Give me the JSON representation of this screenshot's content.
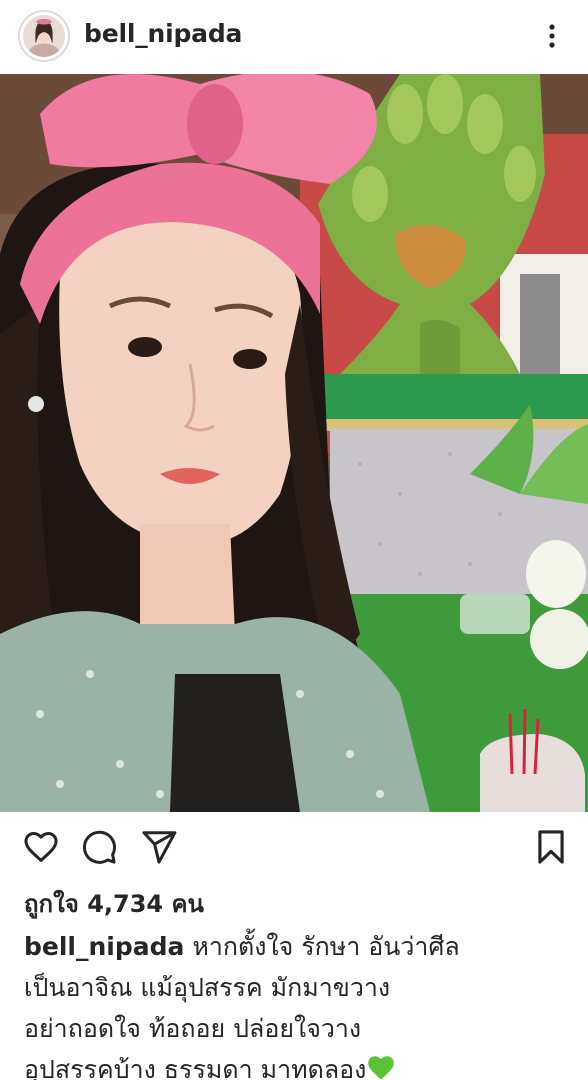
{
  "post": {
    "username": "bell_nipada",
    "likes_text": "ถูกใจ 4,734 คน",
    "caption_lines": [
      "หากตั้งใจ รักษา อันว่าศีล",
      "เป็นอาจิณ แม้อุปสรรค มักมาขวาง",
      "อย่าถอดใจ ท้อถอย ปล่อยใจวาง",
      "อุปสรรคบ้าง ธรรมดา มาทดลอง"
    ]
  },
  "icons": {
    "more": "more-vertical-icon",
    "like": "heart-outline-icon",
    "comment": "comment-bubble-icon",
    "share": "paper-plane-icon",
    "save": "bookmark-icon",
    "emoji": "green-heart-emoji"
  },
  "colors": {
    "text": "#262626",
    "emoji_green": "#5bc236"
  }
}
